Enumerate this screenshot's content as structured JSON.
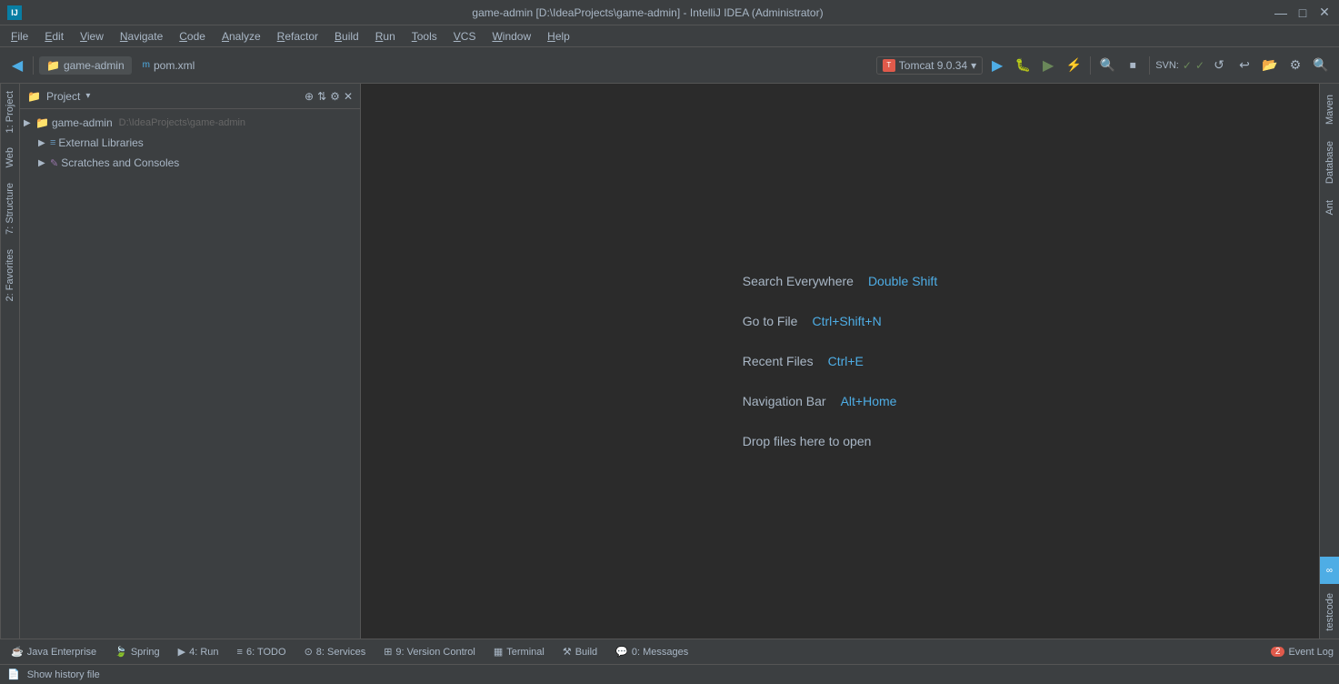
{
  "titlebar": {
    "title": "game-admin [D:\\IdeaProjects\\game-admin] - IntelliJ IDEA (Administrator)",
    "minimize": "—",
    "maximize": "□",
    "close": "✕"
  },
  "menu": {
    "items": [
      "File",
      "Edit",
      "View",
      "Navigate",
      "Code",
      "Analyze",
      "Refactor",
      "Build",
      "Run",
      "Tools",
      "VCS",
      "Window",
      "Help"
    ]
  },
  "toolbar": {
    "project_tab": "game-admin",
    "pom_tab": "pom.xml",
    "tomcat": "Tomcat 9.0.34",
    "svn_label": "SVN:"
  },
  "project_panel": {
    "title": "Project",
    "root_node": "game-admin",
    "root_path": "D:\\IdeaProjects\\game-admin",
    "external_libraries": "External Libraries",
    "scratches": "Scratches and Consoles"
  },
  "editor": {
    "search_everywhere_label": "Search Everywhere",
    "search_everywhere_shortcut": "Double Shift",
    "goto_file_label": "Go to File",
    "goto_file_shortcut": "Ctrl+Shift+N",
    "recent_files_label": "Recent Files",
    "recent_files_shortcut": "Ctrl+E",
    "navigation_bar_label": "Navigation Bar",
    "navigation_bar_shortcut": "Alt+Home",
    "drop_files_text": "Drop files here to open"
  },
  "bottom_tabs": {
    "items": [
      {
        "label": "Java Enterprise",
        "icon": "☕"
      },
      {
        "label": "Spring",
        "icon": "🌿"
      },
      {
        "label": "4: Run",
        "icon": "▶"
      },
      {
        "label": "6: TODO",
        "icon": "≡"
      },
      {
        "label": "8: Services",
        "icon": "⊙"
      },
      {
        "label": "9: Version Control",
        "icon": "⊞"
      },
      {
        "label": "Terminal",
        "icon": "▦"
      },
      {
        "label": "Build",
        "icon": "⚒"
      },
      {
        "label": "0: Messages",
        "icon": "💬"
      }
    ],
    "event_log": "Event Log",
    "event_badge": "2"
  },
  "status_bar": {
    "history_text": "Show history file"
  },
  "right_panels": {
    "maven": "Maven",
    "database": "Database",
    "ant": "Ant",
    "testcode": "testcode"
  },
  "left_tabs": {
    "web": "Web",
    "structure": "7: Structure",
    "favorites": "2: Favorites"
  }
}
